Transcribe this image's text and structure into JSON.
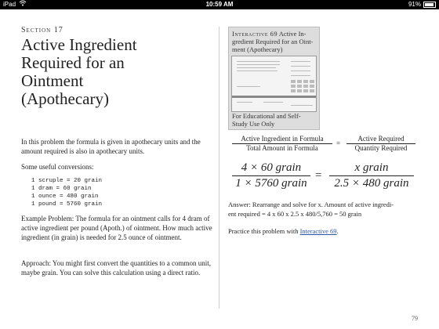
{
  "status_bar": {
    "device": "iPad",
    "time": "10:59 AM",
    "battery": "91%"
  },
  "left": {
    "section": "Section 17",
    "title_lines": [
      "Active Ingredient",
      "Required for an",
      "Ointment",
      "(Apothecary)"
    ],
    "p1": "In this problem the formula is given in apothecary units and the amount required is also in apothecary units.",
    "p2": "Some useful conversions:",
    "conversions": [
      "1 scruple = 20 grain",
      "1 dram = 60 grain",
      "1 ounce = 480 grain",
      "1 pound = 5760 grain"
    ],
    "p3": "Example Problem: The formula for an ointment calls for 4 dram of active ingredient per pound (Apoth.) of ointment. How much active ingredient (in grain) is needed for 2.5 ounce of ointment.",
    "p4": "Approach: You might first convert the quantities to a common unit, maybe grain. You can solve this calculation using a direct ratio."
  },
  "interactive_card": {
    "label": "Interactive 69",
    "title_lines": [
      "Active In-",
      "gredient Required for an Oint-",
      "ment (Apothecary)"
    ],
    "footer_lines": [
      "For Educational and Self-",
      "Study Use Only"
    ]
  },
  "formula1": {
    "left_num": "Active Ingredient in Formula",
    "left_den": "Total Amount in Formula",
    "eq": "=",
    "right_num": "Active Required",
    "right_den": "Quantity Required"
  },
  "formula2": {
    "left_num": "4 × 60 grain",
    "left_den": "1 × 5760 grain",
    "eq": "=",
    "right_num": "x grain",
    "right_den": "2.5 × 480 grain"
  },
  "answer_lines": [
    "Answer: Rearrange and solve for x. Amount of active ingredi-",
    "ent required = 4 x 60 x 2.5 x 480/5,760 = 50 grain"
  ],
  "practice": {
    "prefix": "Practice this problem with ",
    "link": "Interactive 69",
    "suffix": "."
  },
  "page_number": "79"
}
